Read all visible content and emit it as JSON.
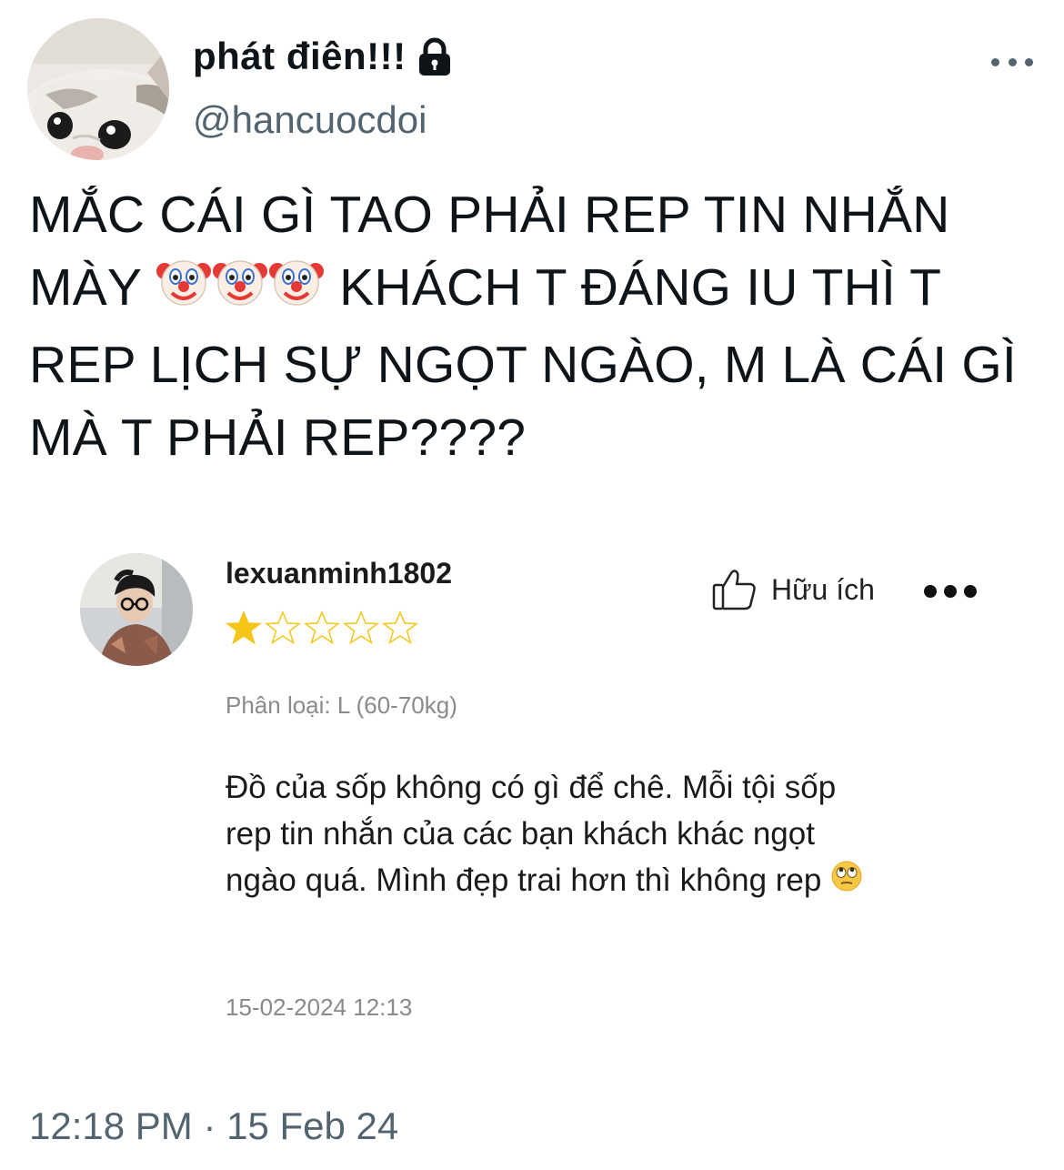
{
  "tweet": {
    "display_name": "phát điên!!!",
    "handle": "@hancuocdoi",
    "locked_icon": "lock-icon",
    "more_icon": "more-horizontal-icon",
    "text_segments": {
      "line1": "MẮC CÁI GÌ TAO PHẢI REP TIN NHẮN",
      "line2_prefix": "MÀY",
      "clown_emoji": "clown-face-emoji",
      "line2_suffix": " KHÁCH T ĐÁNG IU THÌ T",
      "line3": "REP LỊCH SỰ NGỌT NGÀO, M LÀ CÁI GÌ",
      "line4": "MÀ T PHẢI REP????"
    },
    "timestamp": "12:18 PM · 15 Feb 24"
  },
  "review": {
    "username": "lexuanminh1802",
    "rating": 1,
    "max_rating": 5,
    "helpful_label": "Hữu ích",
    "variant": "Phân loại: L (60-70kg)",
    "body": "Đồ của sốp không có gì để chê. Mỗi tội sốp rep tin nhắn của các bạn khách khác ngọt ngào quá. Mình đẹp trai hơn thì không rep",
    "body_emoji": "face-with-rolling-eyes-emoji",
    "date": "15-02-2024",
    "time": "12:13"
  },
  "colors": {
    "text_primary": "#0f1419",
    "text_secondary": "#536471",
    "star_filled": "#f5c518",
    "review_meta": "#8a8a8a"
  }
}
